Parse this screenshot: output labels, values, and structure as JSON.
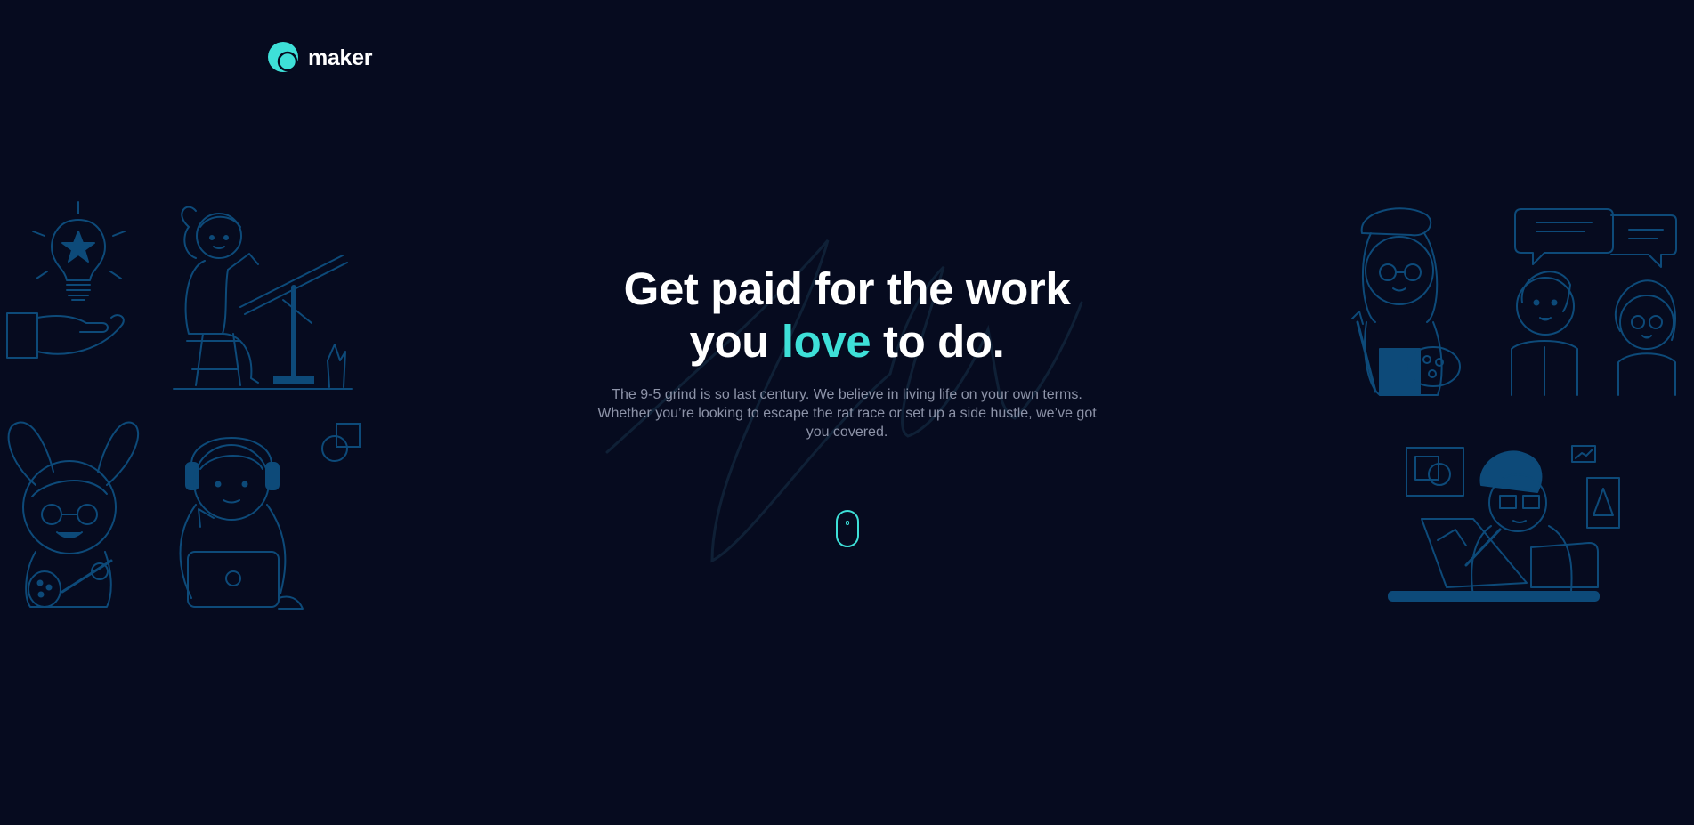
{
  "brand": {
    "name": "maker",
    "accent_color": "#3ee0d8",
    "background_color": "#060b1f",
    "illustration_color": "#0d4a79"
  },
  "hero": {
    "headline_part1": "Get paid for the work",
    "headline_part2_before": "you ",
    "headline_accent": "love",
    "headline_part2_after": " to do.",
    "description": "The 9-5 grind is so last century. We believe in living life on your own terms. Whether you’re looking to escape the rat race or set up a side hustle, we’ve got you covered."
  },
  "scroll_indicator": {
    "icon": "mouse-scroll-icon"
  },
  "illustrations": [
    "lightbulb-hand-icon",
    "designer-at-drafting-table",
    "bunny-ear-painter",
    "headphones-laptop-person",
    "painter-with-palette",
    "people-chatting",
    "artist-at-tablet"
  ]
}
